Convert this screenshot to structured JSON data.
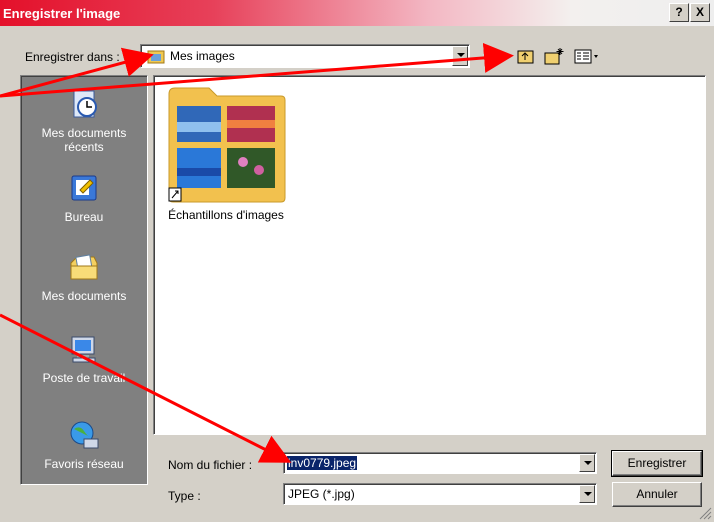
{
  "window": {
    "title": "Enregistrer l'image",
    "help_label": "?",
    "close_label": "X"
  },
  "location": {
    "label": "Enregistrer dans :",
    "value": "Mes images"
  },
  "places": [
    {
      "label": "Mes documents récents",
      "icon": "recent-documents-icon"
    },
    {
      "label": "Bureau",
      "icon": "desktop-icon"
    },
    {
      "label": "Mes documents",
      "icon": "my-documents-icon"
    },
    {
      "label": "Poste de travail",
      "icon": "my-computer-icon"
    },
    {
      "label": "Favoris réseau",
      "icon": "network-places-icon"
    }
  ],
  "files": [
    {
      "name": "Échantillons d'images",
      "type": "folder-shortcut"
    }
  ],
  "filename": {
    "label": "Nom du fichier :",
    "value": "inv0779.jpeg"
  },
  "filetype": {
    "label": "Type :",
    "value": "JPEG (*.jpg)"
  },
  "buttons": {
    "save": "Enregistrer",
    "cancel": "Annuler"
  },
  "colors": {
    "title_bar": "#e4102a",
    "annotation_arrow": "#ff0000",
    "selection": "#0a246a"
  }
}
